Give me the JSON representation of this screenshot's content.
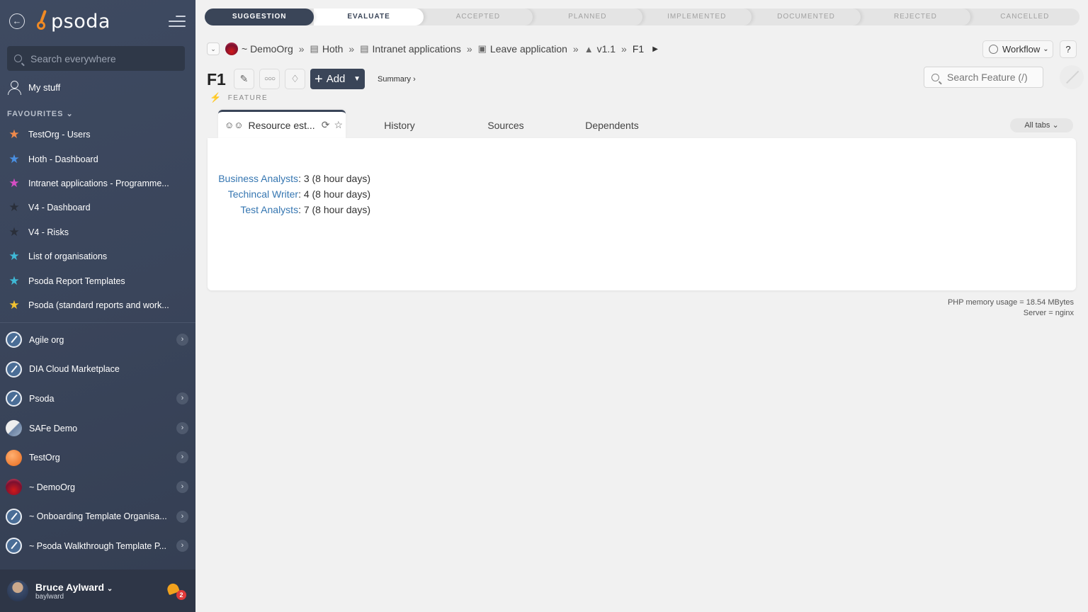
{
  "sidebar": {
    "logo_text": "psoda",
    "search_placeholder": "Search everywhere",
    "my_stuff": "My stuff",
    "favourites_heading": "FAVOURITES",
    "favourites": [
      {
        "label": "TestOrg - Users",
        "star_color": "#f08a4b"
      },
      {
        "label": "Hoth - Dashboard",
        "star_color": "#4a90e2"
      },
      {
        "label": "Intranet applications - Programme...",
        "star_color": "#d64ec4"
      },
      {
        "label": "V4 - Dashboard",
        "star_color": "#2a2f3a"
      },
      {
        "label": "V4 - Risks",
        "star_color": "#2a2f3a"
      },
      {
        "label": "List of organisations",
        "star_color": "#3fb9d6"
      },
      {
        "label": "Psoda Report Templates",
        "star_color": "#3fb9d6"
      },
      {
        "label": "Psoda (standard reports and work...",
        "star_color": "#f2c230"
      }
    ],
    "organisations": [
      {
        "label": "Agile org",
        "icon": "pen",
        "arrow": true
      },
      {
        "label": "DIA Cloud Marketplace",
        "icon": "pen",
        "arrow": false
      },
      {
        "label": "Psoda",
        "icon": "pen",
        "arrow": true
      },
      {
        "label": "SAFe Demo",
        "icon": "safe",
        "arrow": true
      },
      {
        "label": "TestOrg",
        "icon": "testorg",
        "arrow": true
      },
      {
        "label": "~ DemoOrg",
        "icon": "demo",
        "arrow": true
      },
      {
        "label": "~ Onboarding Template Organisa...",
        "icon": "pen",
        "arrow": true
      },
      {
        "label": "~ Psoda Walkthrough Template P...",
        "icon": "pen",
        "arrow": true
      }
    ],
    "user": {
      "name": "Bruce Aylward",
      "login": "baylward",
      "notifications": "2"
    }
  },
  "stages": [
    {
      "label": "SUGGESTION",
      "state": "done"
    },
    {
      "label": "EVALUATE",
      "state": "current"
    },
    {
      "label": "ACCEPTED",
      "state": "todo"
    },
    {
      "label": "PLANNED",
      "state": "todo"
    },
    {
      "label": "IMPLEMENTED",
      "state": "todo"
    },
    {
      "label": "DOCUMENTED",
      "state": "todo"
    },
    {
      "label": "REJECTED",
      "state": "todo"
    },
    {
      "label": "CANCELLED",
      "state": "todo"
    }
  ],
  "breadcrumb": {
    "org": "~ DemoOrg",
    "portfolio": "Hoth",
    "programme": "Intranet applications",
    "project": "Leave application",
    "release": "v1.1",
    "current": "F1"
  },
  "header": {
    "workflow_label": "Workflow",
    "help_label": "?",
    "title": "F1",
    "add_label": "Add",
    "summary_link": "Summary ›",
    "type_label": "FEATURE",
    "search_placeholder": "Search Feature (/)"
  },
  "tabs": {
    "active": "Resource est...",
    "others": [
      "History",
      "Sources",
      "Dependents"
    ],
    "all_tabs": "All tabs"
  },
  "resources": [
    {
      "role": "Business Analysts",
      "value": ": 3 (8 hour days)"
    },
    {
      "role": "Techincal Writer",
      "value": ": 4 (8 hour days)"
    },
    {
      "role": "Test Analysts",
      "value": ": 7 (8 hour days)"
    }
  ],
  "footer": {
    "memory": "PHP memory usage = 18.54 MBytes",
    "server": "Server = nginx"
  }
}
